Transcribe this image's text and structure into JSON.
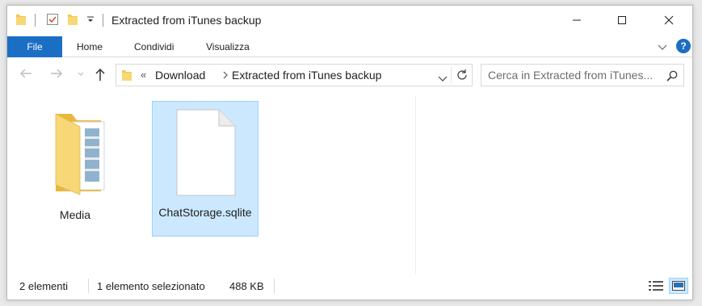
{
  "window": {
    "title": "Extracted from iTunes backup"
  },
  "ribbon": {
    "file_tab": "File",
    "tabs": [
      "Home",
      "Condividi",
      "Visualizza"
    ],
    "help": "?"
  },
  "address": {
    "overflow": "«",
    "crumbs": [
      "Download",
      "Extracted from iTunes backup"
    ]
  },
  "search": {
    "placeholder": "Cerca in Extracted from iTunes..."
  },
  "items": [
    {
      "name": "Media",
      "type": "folder",
      "selected": false
    },
    {
      "name": "ChatStorage.sqlite",
      "type": "file",
      "selected": true
    }
  ],
  "status": {
    "count": "2 elementi",
    "selection": "1 elemento selezionato",
    "size": "488 KB"
  },
  "colors": {
    "accent": "#1a6fc4",
    "selection_bg": "#cce8ff",
    "selection_border": "#99d1ff",
    "folder": "#f8d776"
  }
}
